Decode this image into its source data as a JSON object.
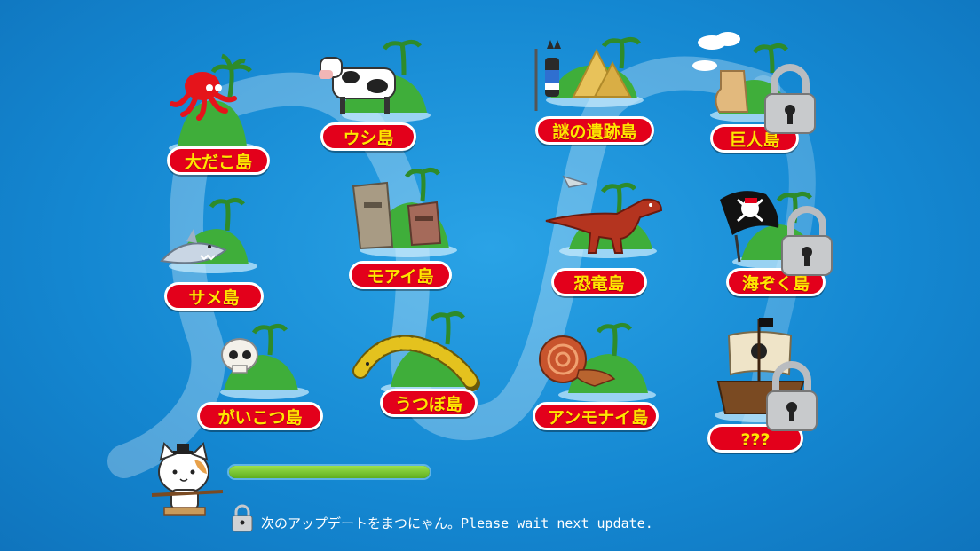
{
  "islands": [
    {
      "label": "大だこ島",
      "icon": "octopus-icon",
      "locked": false
    },
    {
      "label": "ウシ島",
      "icon": "cow-icon",
      "locked": false
    },
    {
      "label": "謎の遺跡島",
      "icon": "anubis-pyramid-icon",
      "locked": false
    },
    {
      "label": "巨人島",
      "icon": "giant-foot-icon",
      "locked": true
    },
    {
      "label": "サメ島",
      "icon": "shark-icon",
      "locked": false
    },
    {
      "label": "モアイ島",
      "icon": "moai-icon",
      "locked": false
    },
    {
      "label": "恐竜島",
      "icon": "dinosaur-icon",
      "locked": false
    },
    {
      "label": "海ぞく島",
      "icon": "pirate-flag-icon",
      "locked": true
    },
    {
      "label": "がいこつ島",
      "icon": "skull-icon",
      "locked": false
    },
    {
      "label": "うつぼ島",
      "icon": "moray-eel-icon",
      "locked": false
    },
    {
      "label": "アンモナイ島",
      "icon": "ammonite-icon",
      "locked": false
    },
    {
      "label": "???",
      "icon": "pirate-ship-icon",
      "locked": true
    }
  ],
  "progress": {
    "fraction": 1.0
  },
  "footer": {
    "update_text": "次のアップデートをまつにゃん。Please wait next update."
  },
  "colors": {
    "background": "#1487d1",
    "label_bg": "#e3001b",
    "label_text": "#ffe600",
    "progress": "#7cc63a"
  }
}
